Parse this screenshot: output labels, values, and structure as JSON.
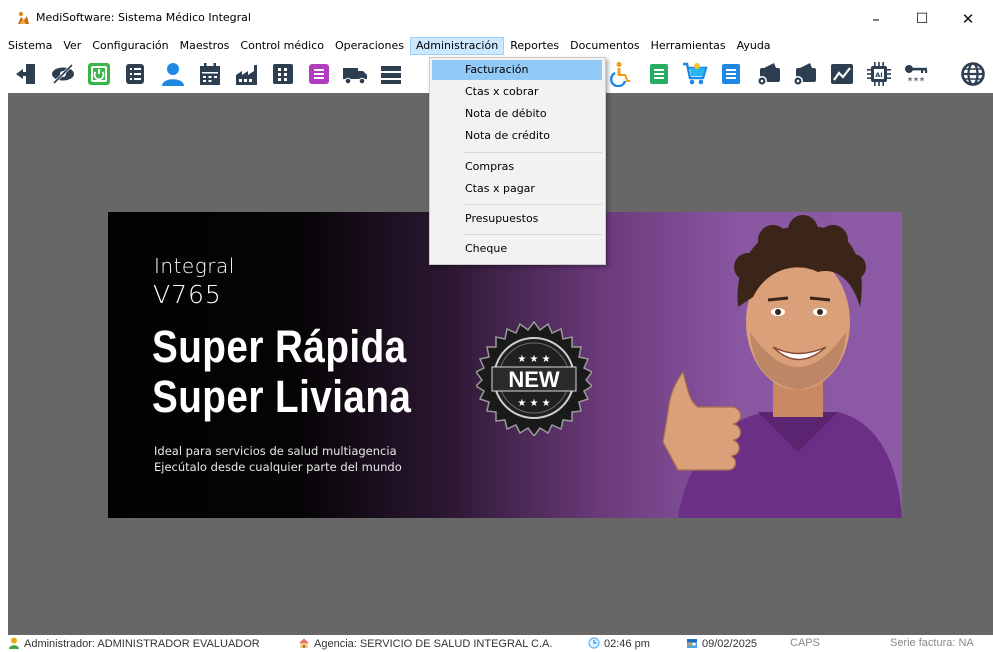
{
  "window": {
    "title": "MediSoftware: Sistema Médico Integral",
    "minimize_glyph": "–",
    "maximize_glyph": "☐",
    "close_glyph": "✕"
  },
  "menubar": {
    "items": [
      "Sistema",
      "Ver",
      "Configuración",
      "Maestros",
      "Control médico",
      "Operaciones",
      "Administración",
      "Reportes",
      "Documentos",
      "Herramientas",
      "Ayuda"
    ],
    "active": "Administración"
  },
  "toolbar": {
    "icons": [
      "exit-door-icon",
      "hide-eye-icon",
      "power-icon",
      "list-icon",
      "user-icon",
      "calendar-icon",
      "factory-icon",
      "grid-icon",
      "document-purple-icon",
      "truck-icon",
      "stack-icon",
      "wheelchair-icon",
      "notes-green-icon",
      "shopping-cart-icon",
      "notes-blue-icon",
      "wallet-gear-icon",
      "wallet-settings-icon",
      "chart-image-icon",
      "ai-chip-icon",
      "key-password-icon",
      "globe-icon"
    ]
  },
  "dropdown": {
    "items": [
      {
        "label": "Facturación",
        "highlighted": true
      },
      {
        "label": "Ctas x cobrar"
      },
      {
        "label": "Nota de débito"
      },
      {
        "label": "Nota de crédito"
      },
      {
        "label": "Compras"
      },
      {
        "label": "Ctas x pagar"
      },
      {
        "label": "Presupuestos"
      },
      {
        "label": "Cheque"
      }
    ]
  },
  "banner": {
    "line1": "Integral",
    "version": "V765",
    "headline1": "Super Rápida",
    "headline2": "Super Liviana",
    "tagline1": "Ideal para servicios de salud multiagencia",
    "tagline2": "Ejecútalo desde cualquier parte del mundo",
    "badge": "NEW"
  },
  "statusbar": {
    "user": "Administrador: ADMINISTRADOR EVALUADOR",
    "agency": "Agencia: SERVICIO DE SALUD INTEGRAL C.A.",
    "time": "02:46 pm",
    "date": "09/02/2025",
    "caps": "CAPS",
    "series": "Serie factura: NA"
  },
  "colors": {
    "workspace": "#676767",
    "menu_active": "#cce8ff",
    "dropdown_highlight": "#91c9f7"
  }
}
